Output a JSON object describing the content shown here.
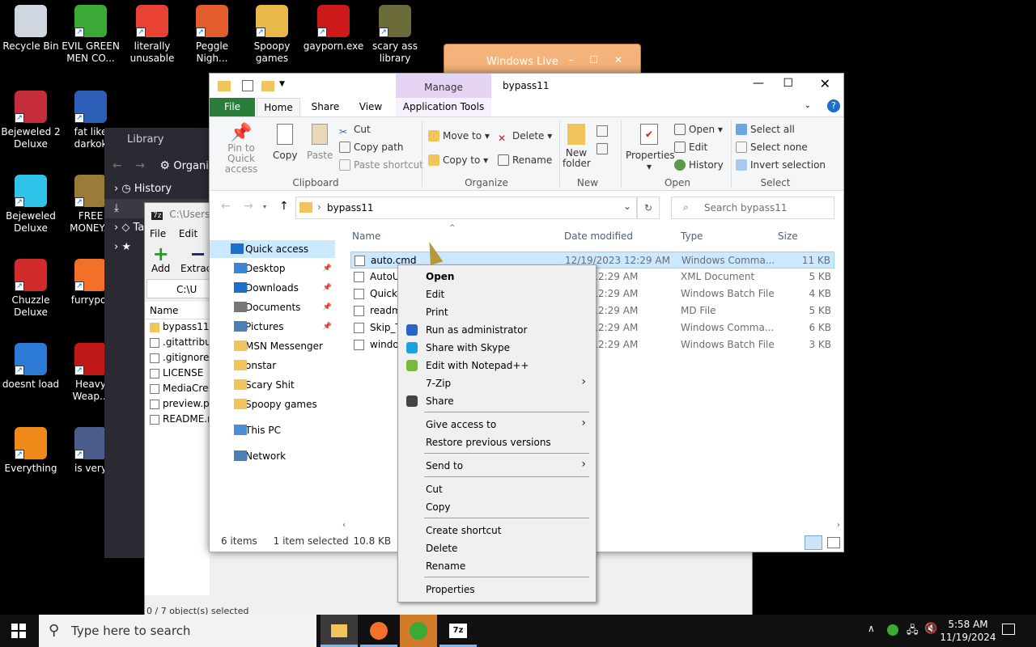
{
  "desktop": {
    "icons": [
      {
        "label": "Recycle Bin",
        "name": "recycle-bin-icon",
        "color": "#cfd6df"
      },
      {
        "label": "EVIL GREEN MEN CO...",
        "name": "green-men-icon",
        "color": "#3aa935"
      },
      {
        "label": "literally unusable",
        "name": "chrome-icon",
        "color": "#e94235"
      },
      {
        "label": "Peggle Nigh...",
        "name": "peggle-icon",
        "color": "#e25d2b"
      },
      {
        "label": "Spoopy games",
        "name": "folder-icon",
        "color": "#e8b84a"
      },
      {
        "label": "gayporn.exe",
        "name": "flash-icon",
        "color": "#cc1a1a"
      },
      {
        "label": "scary ass library",
        "name": "library-icon",
        "color": "#6b6b3a"
      },
      {
        "label": "Bejeweled 2 Deluxe",
        "name": "bejeweled2-icon",
        "color": "#c62d3a"
      },
      {
        "label": "fat like darkok",
        "name": "msn-icon",
        "color": "#2e5fb8"
      },
      {
        "label": "Bejeweled Deluxe",
        "name": "bejeweled-icon",
        "color": "#2fc4ea"
      },
      {
        "label": "FREE MONEY.c",
        "name": "money-icon",
        "color": "#9a7b3a"
      },
      {
        "label": "Chuzzle Deluxe",
        "name": "chuzzle-icon",
        "color": "#d22b2b"
      },
      {
        "label": "furrypor",
        "name": "firefox-icon",
        "color": "#f2702a"
      },
      {
        "label": "doesnt load",
        "name": "thunderbird-icon",
        "color": "#2a7ad6"
      },
      {
        "label": "Heavy Weap...",
        "name": "heavy-weapon-icon",
        "color": "#c01717"
      },
      {
        "label": "Everything",
        "name": "everything-icon",
        "color": "#f08a1a"
      },
      {
        "label": "is very",
        "name": "msn-plus-icon",
        "color": "#4a5d8c"
      }
    ]
  },
  "winlive": {
    "title": "Windows Live"
  },
  "library": {
    "title": "Library",
    "organize": "Organi",
    "items": [
      "History",
      "",
      "Tags"
    ]
  },
  "zip": {
    "path": "C:\\Users\\",
    "menu": [
      "File",
      "Edit",
      "V"
    ],
    "add": "Add",
    "extract": "Extract",
    "addr": "C:\\U",
    "col_name": "Name",
    "files": [
      "bypass11",
      ".gitattribut",
      ".gitignore",
      "LICENSE",
      "MediaCrea",
      "preview.pr",
      "README.m"
    ],
    "status": "0 / 7 object(s) selected"
  },
  "explorer": {
    "title": "bypass11",
    "manage": "Manage",
    "tabs": [
      "File",
      "Home",
      "Share",
      "View",
      "Application Tools"
    ],
    "ribbon": {
      "pin": "Pin to Quick access",
      "copy": "Copy",
      "paste": "Paste",
      "cut": "Cut",
      "copy_path": "Copy path",
      "paste_shortcut": "Paste shortcut",
      "move_to": "Move to",
      "copy_to": "Copy to",
      "delete": "Delete",
      "rename": "Rename",
      "new_folder": "New folder",
      "properties": "Properties",
      "open": "Open",
      "edit": "Edit",
      "history": "History",
      "select_all": "Select all",
      "select_none": "Select none",
      "invert": "Invert selection",
      "groups": [
        "Clipboard",
        "Organize",
        "New",
        "Open",
        "Select"
      ]
    },
    "address": "bypass11",
    "search": "Search bypass11",
    "nav": [
      "Quick access",
      "Desktop",
      "Downloads",
      "Documents",
      "Pictures",
      "MSN Messenger",
      "onstar",
      "Scary Shit",
      "Spoopy games",
      "This PC",
      "Network"
    ],
    "columns": [
      "Name",
      "Date modified",
      "Type",
      "Size"
    ],
    "files": [
      {
        "name": "auto.cmd",
        "date": "12/19/2023 12:29 AM",
        "type": "Windows Comma...",
        "size": "11 KB"
      },
      {
        "name": "AutoU",
        "date": "2023 12:29 AM",
        "type": "XML Document",
        "size": "5 KB"
      },
      {
        "name": "Quick_",
        "date": "2023 12:29 AM",
        "type": "Windows Batch File",
        "size": "4 KB"
      },
      {
        "name": "readm",
        "date": "2023 12:29 AM",
        "type": "MD File",
        "size": "5 KB"
      },
      {
        "name": "Skip_T",
        "date": "2023 12:29 AM",
        "type": "Windows Comma...",
        "size": "6 KB"
      },
      {
        "name": "windo",
        "date": "2023 12:29 AM",
        "type": "Windows Batch File",
        "size": "3 KB"
      }
    ],
    "status_items": "6 items",
    "status_selected": "1 item selected",
    "status_size": "10.8 KB"
  },
  "context_menu": [
    "Open",
    "Edit",
    "Print",
    "Run as administrator",
    "Share with Skype",
    "Edit with Notepad++",
    "7-Zip",
    "Share",
    "Give access to",
    "Restore previous versions",
    "Send to",
    "Cut",
    "Copy",
    "Create shortcut",
    "Delete",
    "Rename",
    "Properties"
  ],
  "taskbar": {
    "search": "Type here to search",
    "time": "5:58 AM",
    "date": "11/19/2024"
  }
}
